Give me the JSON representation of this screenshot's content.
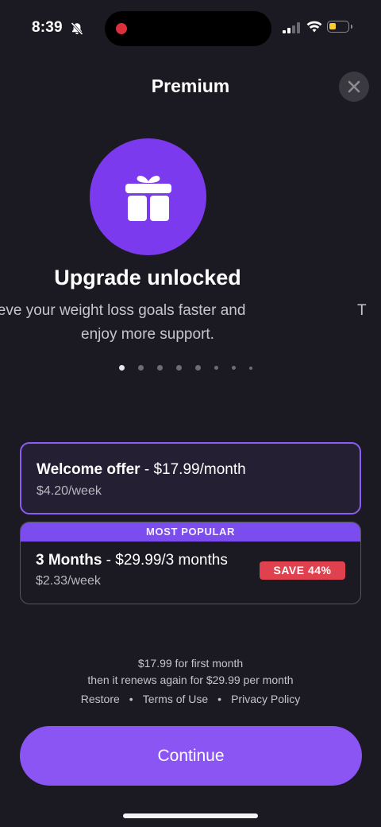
{
  "status_bar": {
    "time": "8:39",
    "icons": [
      "bell-slash-icon",
      "recording-dot",
      "signal-icon",
      "wifi-icon",
      "battery-icon"
    ],
    "battery_color": "#f7ce2e"
  },
  "header": {
    "title": "Premium",
    "close_icon": "close-icon"
  },
  "hero": {
    "icon": "gift-icon",
    "icon_bg": "#7c3aee",
    "headline": "Upgrade unlocked",
    "subtitle_line1": "hieve your weight loss goals faster and",
    "subtitle_line2": "enjoy more support.",
    "next_peek": "T",
    "pager": {
      "count": 8,
      "active_index": 0
    }
  },
  "plans": [
    {
      "name": "Welcome offer",
      "separator": " - ",
      "price": "$17.99/month",
      "weekly": "$4.20/week",
      "selected": true
    },
    {
      "badge_top": "MOST POPULAR",
      "name": "3 Months",
      "separator": " - ",
      "price": "$29.99/3 months",
      "weekly": "$2.33/week",
      "save_badge": "SAVE 44%",
      "selected": false
    }
  ],
  "footer": {
    "info_line1": "$17.99 for first month",
    "info_line2": "then it renews again for $29.99 per month",
    "links": [
      "Restore",
      "Terms of Use",
      "Privacy Policy"
    ],
    "link_separator": "•",
    "continue_label": "Continue"
  },
  "colors": {
    "background": "#1b1a22",
    "accent": "#8b55f4",
    "save_red": "#e0414f"
  }
}
